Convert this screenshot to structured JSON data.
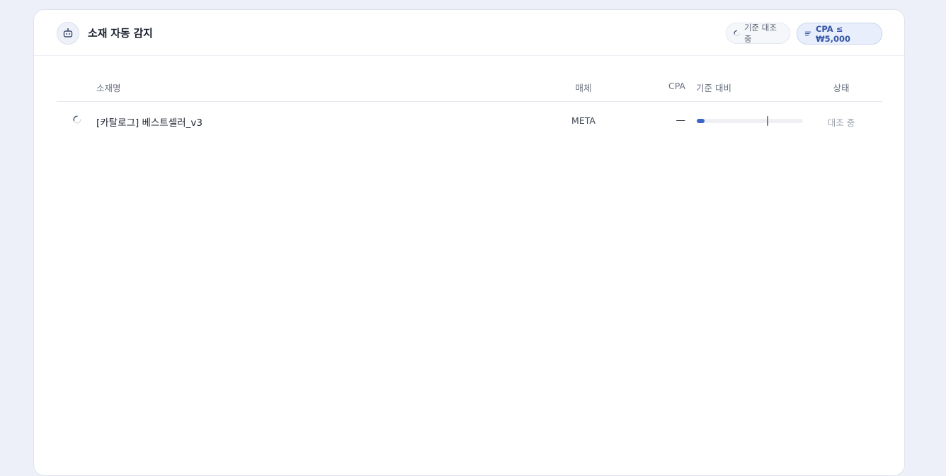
{
  "colors": {
    "background": "#edf0f8",
    "panel": "#ffffff",
    "accent": "#3a66c9",
    "filter_chip_text": "#3556a6",
    "muted_text": "#9aa0ab"
  },
  "header": {
    "icon": "robot-icon",
    "title": "소재 자동 감지",
    "status_chip": {
      "icon": "spinner-icon",
      "label": "기준 대조 중"
    },
    "filter_chip": {
      "icon": "filter-lines-icon",
      "label": "CPA ≤ ₩5,000"
    }
  },
  "table": {
    "columns": {
      "name": "소재명",
      "media": "매체",
      "cpa": "CPA",
      "vs_baseline": "기준 대비",
      "status": "상태"
    },
    "rows": [
      {
        "icon": "spinner-icon",
        "name": "[카탈로그] 베스트셀러_v3",
        "media": "META",
        "cpa": "—",
        "progress_fraction": 0.07,
        "baseline_fraction": 0.66,
        "status": "대조 중"
      }
    ]
  }
}
